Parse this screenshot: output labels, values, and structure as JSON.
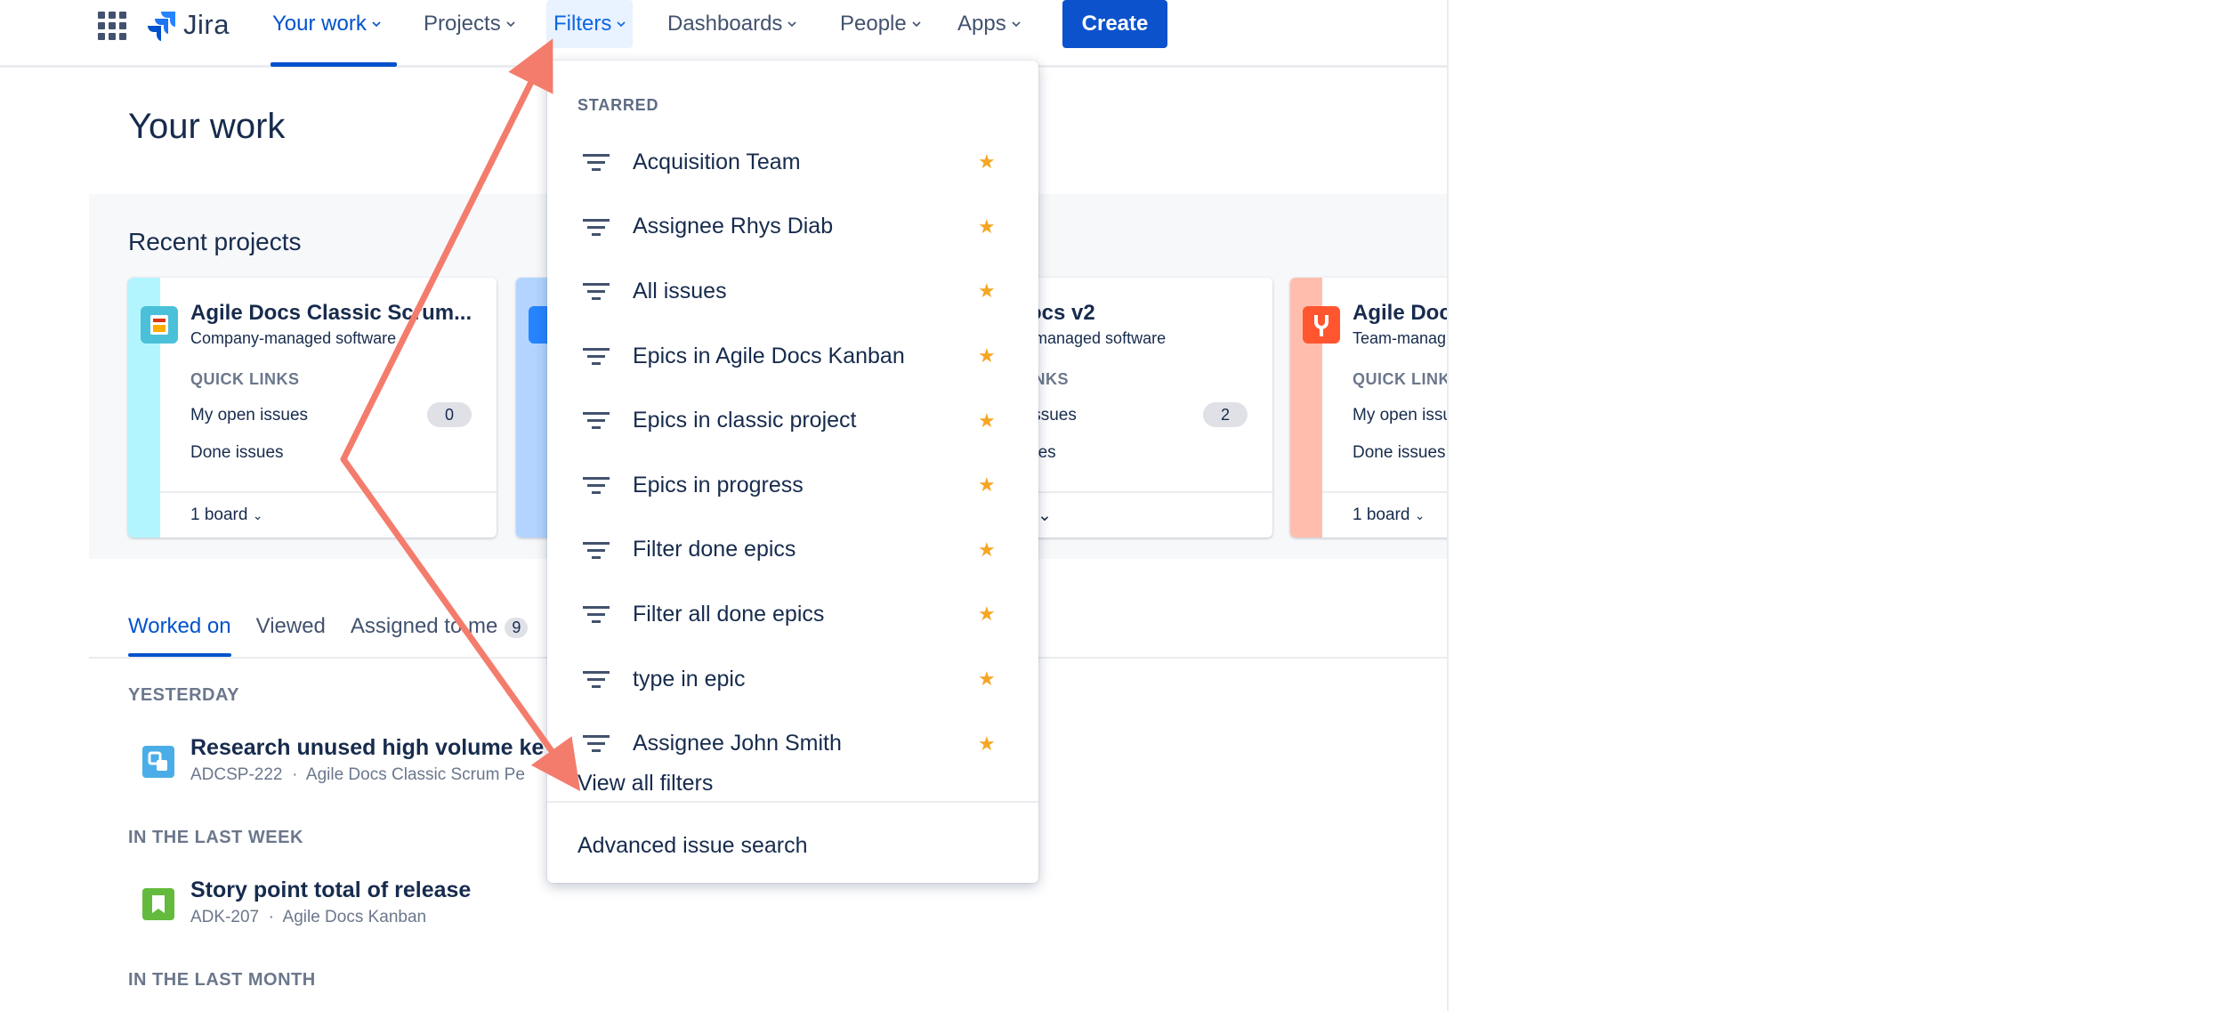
{
  "nav": {
    "logo_text": "Jira",
    "items": [
      {
        "label": "Your work"
      },
      {
        "label": "Projects"
      },
      {
        "label": "Filters"
      },
      {
        "label": "Dashboards"
      },
      {
        "label": "People"
      },
      {
        "label": "Apps"
      }
    ],
    "create_label": "Create",
    "accent_color": "#0052cc"
  },
  "main": {
    "title": "Your work",
    "recent_projects_title": "Recent projects",
    "projects": [
      {
        "name": "Agile Docs Classic Scrum...",
        "type": "Company-managed software",
        "quick_links": "QUICK LINKS",
        "open_label": "My open issues",
        "open_count": "0",
        "done_label": "Done issues",
        "boards": "1 board",
        "color": "#b3f5ff"
      },
      {
        "name": "",
        "type": "",
        "quick_links": "",
        "open_label": "",
        "open_count": "",
        "done_label": "",
        "boards": "",
        "color": "#b3d4ff"
      },
      {
        "name": "ocs v2",
        "type": "-managed software",
        "quick_links": "INKS",
        "open_label": "issues",
        "open_count": "2",
        "done_label": "ues",
        "boards": "",
        "color": "#ffffff"
      },
      {
        "name": "Agile Doc",
        "type": "Team-manag",
        "quick_links": "QUICK LINK",
        "open_label": "My open issu",
        "open_count": "",
        "done_label": "Done issues",
        "boards": "1 board",
        "color": "#ffbdad"
      }
    ],
    "tabs": [
      {
        "label": "Worked on"
      },
      {
        "label": "Viewed"
      },
      {
        "label": "Assigned to me",
        "badge": "9"
      }
    ],
    "sections": [
      {
        "label": "YESTERDAY",
        "items": [
          {
            "title": "Research unused high volume keyw",
            "key": "ADCSP-222",
            "project": "Agile Docs Classic Scrum Pe"
          }
        ]
      },
      {
        "label": "IN THE LAST WEEK",
        "items": [
          {
            "title": "Story point total of release",
            "key": "ADK-207",
            "project": "Agile Docs Kanban"
          }
        ]
      },
      {
        "label": "IN THE LAST MONTH",
        "items": []
      }
    ],
    "meta_separator": "·"
  },
  "filters_dropdown": {
    "heading": "STARRED",
    "items": [
      {
        "label": "Acquisition Team"
      },
      {
        "label": "Assignee Rhys Diab"
      },
      {
        "label": "All issues"
      },
      {
        "label": "Epics in Agile Docs Kanban"
      },
      {
        "label": "Epics in classic project"
      },
      {
        "label": "Epics in progress"
      },
      {
        "label": "Filter done epics"
      },
      {
        "label": "Filter all done epics"
      },
      {
        "label": "type in epic"
      },
      {
        "label": "Assignee John Smith"
      }
    ],
    "star_glyph": "★",
    "star_color": "#f5a623",
    "view_all": "View all filters",
    "advanced": "Advanced issue search"
  },
  "annotation": {
    "color": "#f47c6c"
  }
}
